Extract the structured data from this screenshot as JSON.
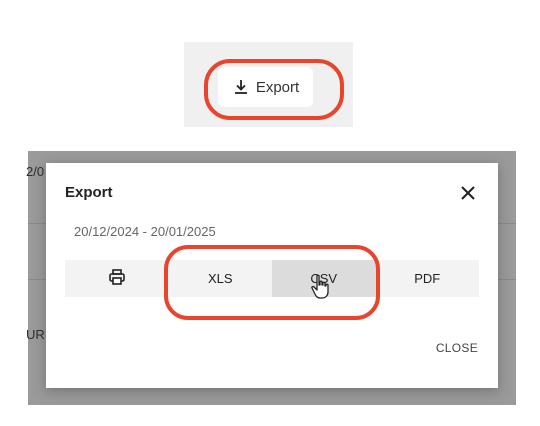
{
  "toolbar": {
    "export_label": "Export",
    "export_icon": "download-icon"
  },
  "background": {
    "fragment_top": "2/0",
    "fragment_side": "UR"
  },
  "dialog": {
    "title": "Export",
    "close_icon": "close-icon",
    "date_range": "20/12/2024 - 20/01/2025",
    "formats": [
      {
        "label": "",
        "icon": "print-icon"
      },
      {
        "label": "XLS"
      },
      {
        "label": "CSV"
      },
      {
        "label": "PDF"
      }
    ],
    "close_label": "CLOSE"
  },
  "colors": {
    "annotation": "#e8452f",
    "overlay": "#9a9a9a",
    "hover_segment": "#dcdcdc"
  }
}
